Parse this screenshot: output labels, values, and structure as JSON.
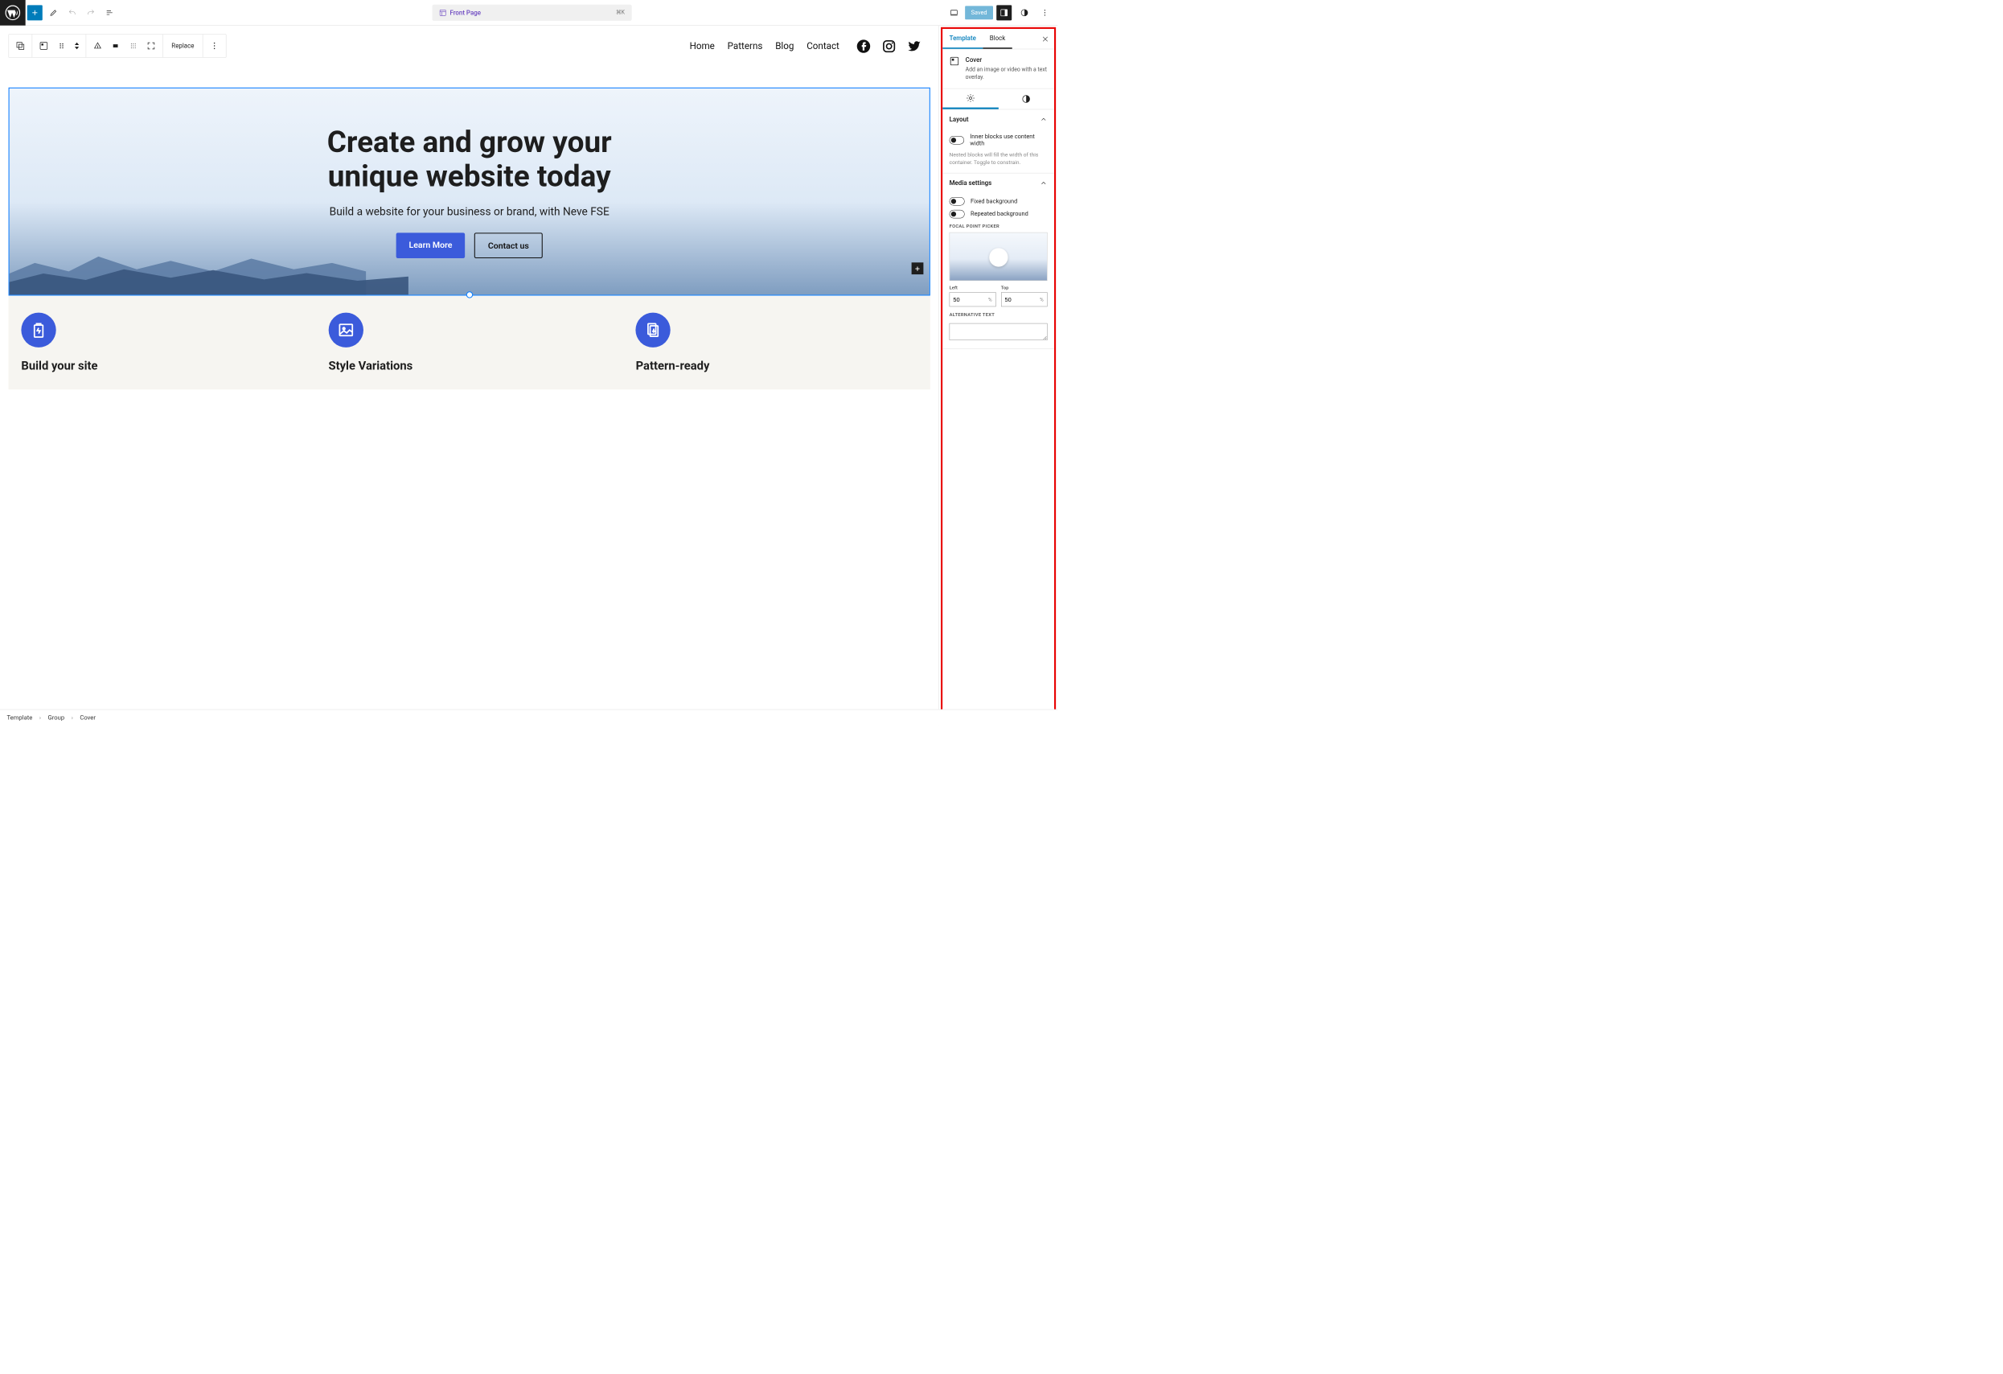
{
  "topbar": {
    "page_title": "Front Page",
    "shortcut": "⌘K",
    "saved_label": "Saved"
  },
  "block_toolbar": {
    "replace_label": "Replace"
  },
  "site_nav": {
    "items": [
      "Home",
      "Patterns",
      "Blog",
      "Contact"
    ]
  },
  "cover": {
    "heading_line1": "Create and grow your",
    "heading_line2": "unique website today",
    "subheading": "Build a website for your business or brand, with Neve FSE",
    "primary_btn": "Learn More",
    "secondary_btn": "Contact us"
  },
  "features": [
    {
      "title": "Build your site"
    },
    {
      "title": "Style Variations"
    },
    {
      "title": "Pattern-ready"
    }
  ],
  "sidebar": {
    "tabs": {
      "template": "Template",
      "block": "Block"
    },
    "block_info": {
      "title": "Cover",
      "description": "Add an image or video with a text overlay."
    },
    "layout": {
      "heading": "Layout",
      "toggle_label": "Inner blocks use content width",
      "help": "Nested blocks will fill the width of this container. Toggle to constrain."
    },
    "media": {
      "heading": "Media settings",
      "fixed_bg": "Fixed background",
      "repeated_bg": "Repeated background",
      "focal_label": "Focal point picker",
      "left_label": "Left",
      "top_label": "Top",
      "left_value": "50",
      "top_value": "50",
      "pct": "%",
      "alt_label": "Alternative text"
    }
  },
  "breadcrumb": [
    "Template",
    "Group",
    "Cover"
  ]
}
